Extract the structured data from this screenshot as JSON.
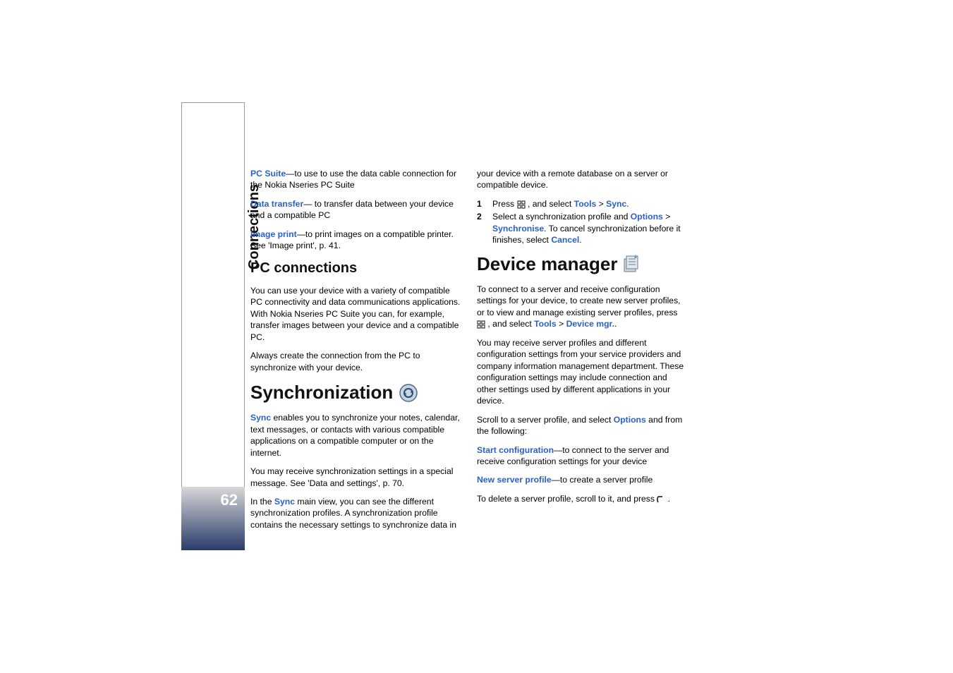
{
  "sidebar": {
    "label": "Connections",
    "page_number": "62"
  },
  "left": {
    "pc_suite_label": "PC Suite",
    "pc_suite_text": "—to use to use the data cable connection for the Nokia Nseries PC Suite",
    "data_transfer_label": "Data transfer",
    "data_transfer_text": "— to transfer data between your device and a compatible PC",
    "image_print_label": "Image print",
    "image_print_text": "—to print images on a compatible printer. See 'Image print', p. 41.",
    "pc_conn_heading": "PC connections",
    "pc_conn_p1": "You can use your device with a variety of compatible PC connectivity and data communications applications. With Nokia Nseries PC Suite you can, for example, transfer images between your device and a compatible PC.",
    "pc_conn_p2": "Always create the connection from the PC to synchronize with your device.",
    "sync_heading": "Synchronization",
    "sync_label": "Sync",
    "sync_p1": " enables you to synchronize your notes, calendar, text messages, or contacts with various compatible applications on a compatible computer or on the internet.",
    "sync_p2": "You may receive synchronization settings in a special message. See 'Data and settings', p. 70.",
    "sync_p3a": "In the ",
    "sync_p3b": " main view, you can see the different synchronization profiles. A synchronization profile contains the necessary settings to synchronize data in"
  },
  "right": {
    "top_p": "your device with a remote database on a server or compatible device.",
    "step1_num": "1",
    "step1_a": "Press ",
    "step1_b": " , and select ",
    "step1_tools": "Tools",
    "step1_gt": " > ",
    "step1_sync": "Sync",
    "step1_dot": ".",
    "step2_num": "2",
    "step2_a": "Select a synchronization profile and ",
    "step2_options": "Options",
    "step2_gt": " > ",
    "step2_synchronise": "Synchronise",
    "step2_b": ". To cancel synchronization before it finishes, select ",
    "step2_cancel": "Cancel",
    "step2_dot": ".",
    "dev_heading": "Device manager",
    "dev_p1a": "To connect to a server and receive configuration settings for your device, to create new server profiles, or to view and manage existing server profiles, press ",
    "dev_p1b": " , and select ",
    "dev_tools": "Tools",
    "dev_gt": " > ",
    "dev_mgr": "Device mgr.",
    "dev_dot": ".",
    "dev_p2": "You may receive server profiles and different configuration settings from your service providers and company information management department. These configuration settings may include connection and other settings used by different applications in your device.",
    "dev_p3a": "Scroll to a server profile, and select ",
    "dev_p3_options": "Options",
    "dev_p3b": " and from the following:",
    "start_conf_label": "Start configuration",
    "start_conf_text": "—to connect to the server and receive configuration settings for your device",
    "new_server_label": "New server profile",
    "new_server_text": "—to create a server profile",
    "delete_p_a": "To delete a server profile, scroll to it, and press ",
    "delete_p_b": "."
  }
}
